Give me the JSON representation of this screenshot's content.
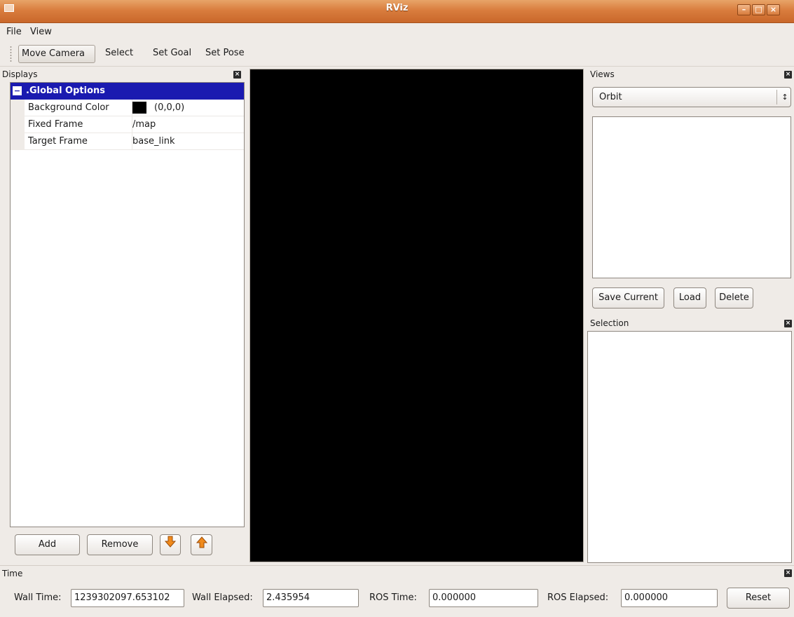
{
  "window": {
    "title": "RViz"
  },
  "menu": {
    "file": "File",
    "view": "View"
  },
  "toolbar": {
    "tools": [
      "Move Camera",
      "Select",
      "Set Goal",
      "Set Pose"
    ]
  },
  "displays": {
    "title": "Displays",
    "tree": [
      {
        "key": ".Global Options",
        "value": ""
      },
      {
        "key": "Background Color",
        "value": "(0,0,0)",
        "color": "#000000"
      },
      {
        "key": "Fixed Frame",
        "value": "/map"
      },
      {
        "key": "Target Frame",
        "value": "base_link"
      }
    ],
    "add_label": "Add",
    "remove_label": "Remove"
  },
  "views": {
    "title": "Views",
    "selected": "Orbit",
    "save_label": "Save Current",
    "load_label": "Load",
    "delete_label": "Delete"
  },
  "selection": {
    "title": "Selection"
  },
  "time": {
    "title": "Time",
    "wall_time_label": "Wall Time:",
    "wall_time_value": "1239302097.653102",
    "wall_elapsed_label": "Wall Elapsed:",
    "wall_elapsed_value": "2.435954",
    "ros_time_label": "ROS Time:",
    "ros_time_value": "0.000000",
    "ros_elapsed_label": "ROS Elapsed:",
    "ros_elapsed_value": "0.000000",
    "reset_label": "Reset"
  },
  "colors": {
    "titlebar": "#d97d3e",
    "selection_highlight": "#1a1ab0",
    "render_background": "#000000"
  }
}
